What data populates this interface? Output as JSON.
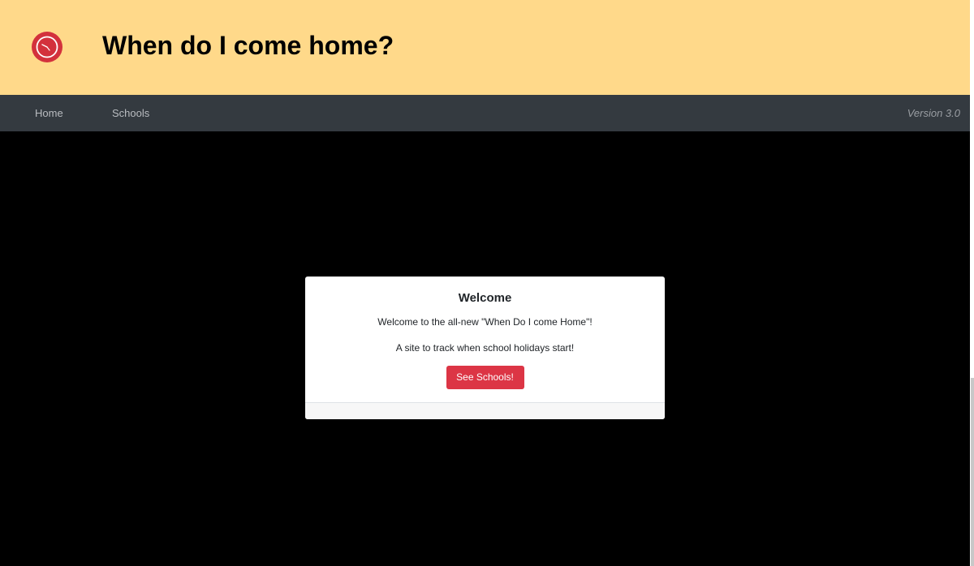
{
  "header": {
    "title": "When do I come home?",
    "logo_icon": "clock-icon",
    "background_color": "#ffd98a"
  },
  "navbar": {
    "items": [
      {
        "label": "Home"
      },
      {
        "label": "Schools"
      }
    ],
    "version": "Version 3.0",
    "background_color": "#343a40"
  },
  "modal": {
    "title": "Welcome",
    "text_1": "Welcome to the all-new \"When Do I come Home\"!",
    "text_2": "A site to track when school holidays start!",
    "button_label": "See Schools!",
    "button_color": "#dc3545"
  }
}
